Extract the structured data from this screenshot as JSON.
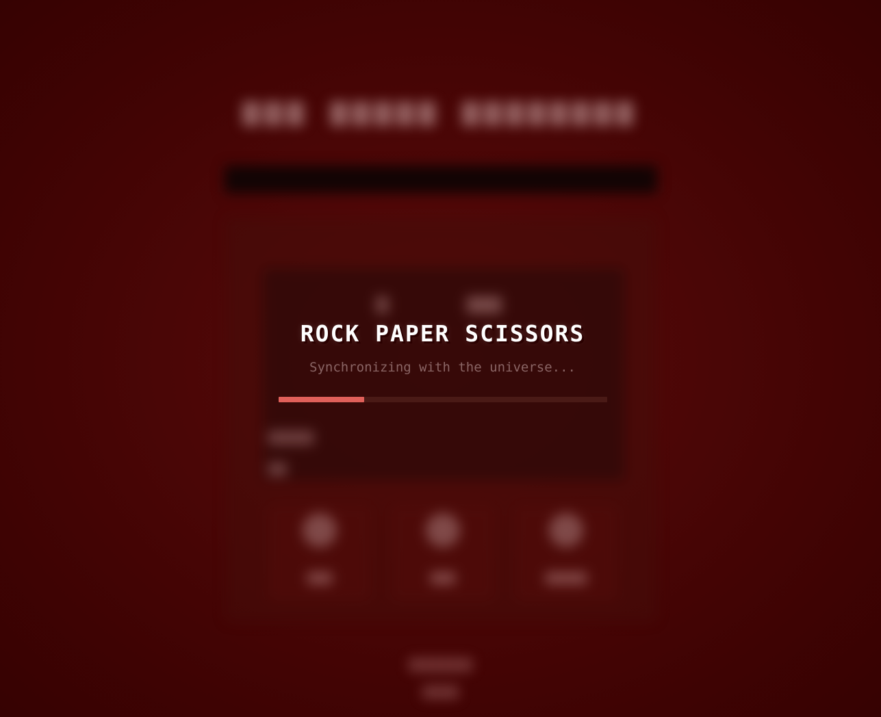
{
  "loading": {
    "title": "ROCK PAPER SCISSORS",
    "subtitle": "Synchronizing with the universe...",
    "progress": 0.26
  },
  "colors": {
    "background": "#4a0606",
    "progress_fill": "#e0605a",
    "progress_track": "#4a1a16",
    "title": "#ffffff",
    "subtitle": "#8a6565"
  }
}
